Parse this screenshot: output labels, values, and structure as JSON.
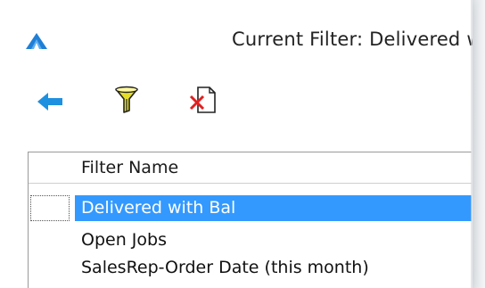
{
  "window": {
    "title": "Current Filter: Delivered with Bal",
    "logo_icon": "triangle-logo-icon",
    "accent_color": "#3399ff"
  },
  "toolbar": {
    "buttons": [
      {
        "name": "back",
        "icon": "left-arrow-icon",
        "color": "#1e90e0"
      },
      {
        "name": "filter",
        "icon": "funnel-icon",
        "color": "#e8e020"
      },
      {
        "name": "delete",
        "icon": "delete-document-icon",
        "color": "#e02020"
      }
    ]
  },
  "grid": {
    "column_header": "Filter Name",
    "rows": [
      {
        "label": "Delivered with Bal",
        "selected": true
      },
      {
        "label": "Open Jobs",
        "selected": false
      },
      {
        "label": "SalesRep-Order Date (this month)",
        "selected": false
      }
    ]
  }
}
